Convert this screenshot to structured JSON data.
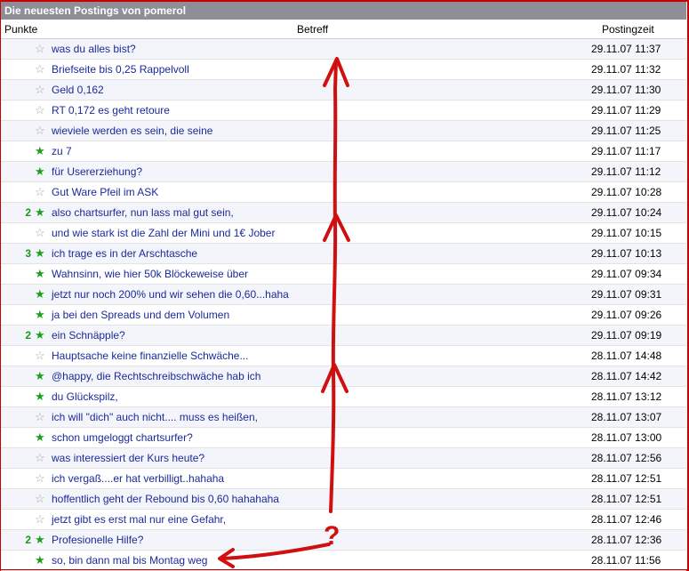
{
  "title": "Die neuesten Postings von pomerol",
  "columns": {
    "points": "Punkte",
    "subject": "Betreff",
    "time": "Postingzeit"
  },
  "annotation": {
    "question_mark": "?"
  },
  "rows": [
    {
      "points": "",
      "star": "grey",
      "subject": "was du alles bist?",
      "time": "29.11.07 11:37"
    },
    {
      "points": "",
      "star": "grey",
      "subject": "Briefseite bis 0,25 Rappelvoll",
      "time": "29.11.07 11:32"
    },
    {
      "points": "",
      "star": "grey",
      "subject": "Geld 0,162",
      "time": "29.11.07 11:30"
    },
    {
      "points": "",
      "star": "grey",
      "subject": "RT 0,172 es geht retoure",
      "time": "29.11.07 11:29"
    },
    {
      "points": "",
      "star": "grey",
      "subject": "wieviele werden es sein, die seine",
      "time": "29.11.07 11:25"
    },
    {
      "points": "",
      "star": "green",
      "subject": "zu 7",
      "time": "29.11.07 11:17"
    },
    {
      "points": "",
      "star": "green",
      "subject": "für Usererziehung?",
      "time": "29.11.07 11:12"
    },
    {
      "points": "",
      "star": "grey",
      "subject": "Gut Ware Pfeil im ASK",
      "time": "29.11.07 10:28"
    },
    {
      "points": "2",
      "star": "green",
      "subject": "also chartsurfer, nun lass mal gut sein,",
      "time": "29.11.07 10:24"
    },
    {
      "points": "",
      "star": "grey",
      "subject": "und wie stark ist die Zahl der Mini und 1€ Jober",
      "time": "29.11.07 10:15"
    },
    {
      "points": "3",
      "star": "green",
      "subject": "ich trage es in der Arschtasche",
      "time": "29.11.07 10:13"
    },
    {
      "points": "",
      "star": "green",
      "subject": "Wahnsinn, wie hier 50k Blöckeweise über",
      "time": "29.11.07 09:34"
    },
    {
      "points": "",
      "star": "green",
      "subject": "jetzt nur noch 200% und wir sehen die 0,60...haha",
      "time": "29.11.07 09:31"
    },
    {
      "points": "",
      "star": "green",
      "subject": "ja bei den Spreads und dem Volumen",
      "time": "29.11.07 09:26"
    },
    {
      "points": "2",
      "star": "green",
      "subject": "ein Schnäpple?",
      "time": "29.11.07 09:19"
    },
    {
      "points": "",
      "star": "grey",
      "subject": "Hauptsache keine finanzielle Schwäche...",
      "time": "28.11.07 14:48"
    },
    {
      "points": "",
      "star": "green",
      "subject": "@happy, die Rechtschreibschwäche hab ich",
      "time": "28.11.07 14:42"
    },
    {
      "points": "",
      "star": "green",
      "subject": "du Glückspilz,",
      "time": "28.11.07 13:12"
    },
    {
      "points": "",
      "star": "grey",
      "subject": "ich will \"dich\" auch nicht.... muss es heißen,",
      "time": "28.11.07 13:07"
    },
    {
      "points": "",
      "star": "green",
      "subject": "schon umgeloggt chartsurfer?",
      "time": "28.11.07 13:00"
    },
    {
      "points": "",
      "star": "grey",
      "subject": "was interessiert der Kurs heute?",
      "time": "28.11.07 12:56"
    },
    {
      "points": "",
      "star": "grey",
      "subject": "ich vergaß....er hat verbilligt..hahaha",
      "time": "28.11.07 12:51"
    },
    {
      "points": "",
      "star": "grey",
      "subject": "hoffentlich geht der Rebound bis 0,60 hahahaha",
      "time": "28.11.07 12:51"
    },
    {
      "points": "",
      "star": "grey",
      "subject": "jetzt gibt es erst mal nur eine Gefahr,",
      "time": "28.11.07 12:46"
    },
    {
      "points": "2",
      "star": "green",
      "subject": "Profesionelle Hilfe?",
      "time": "28.11.07 12:36"
    },
    {
      "points": "",
      "star": "green",
      "subject": "so, bin dann mal bis Montag weg",
      "time": "28.11.07 11:56"
    }
  ],
  "colors": {
    "header": "#8d8e98",
    "link": "#1a2a9a",
    "annotation": "#d01010",
    "star_green": "#1aa01a",
    "star_grey": "#a8a8a8"
  },
  "icons": {
    "star": "star-icon"
  }
}
